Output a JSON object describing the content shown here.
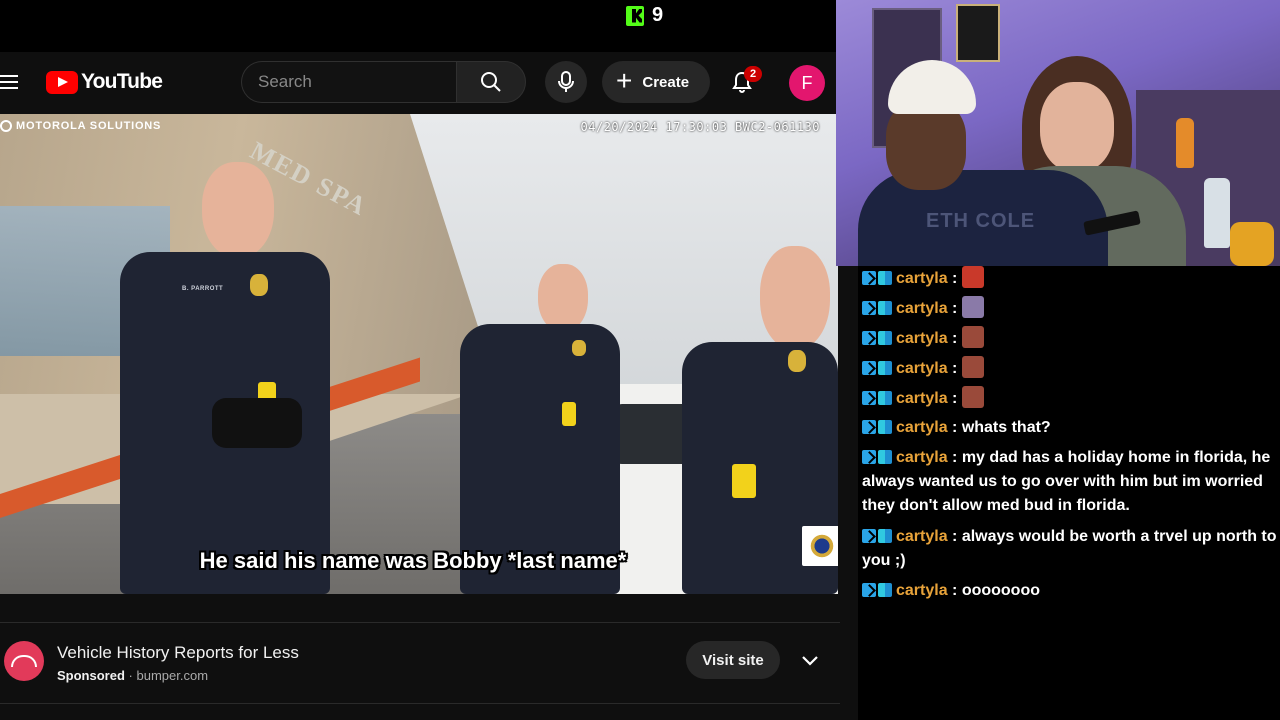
{
  "kick": {
    "viewer_count": "9",
    "logo_icon": "kick-logo-icon"
  },
  "youtube": {
    "logo_text": "YouTube",
    "search": {
      "placeholder": "Search"
    },
    "create_label": "Create",
    "notifications_count": "2",
    "avatar_letter": "F",
    "colors": {
      "brand_red": "#ff0000",
      "avatar_bg": "#e3166e",
      "badge_red": "#cc0000"
    }
  },
  "video": {
    "bwc_brand": "MOTOROLA SOLUTIONS",
    "bwc_stamp": "04/20/2024 17:30:03 BWC2-061130",
    "storefront_sign": "MED SPA",
    "officer_nametag": "B. PARROTT",
    "subtitle": "He said his name was Bobby *last name*"
  },
  "ad": {
    "title": "Vehicle History Reports for Less",
    "sponsored": "Sponsored",
    "separator": "·",
    "domain": "bumper.com",
    "visit_label": "Visit site"
  },
  "webcam": {
    "shirt_text": "ETH COLE"
  },
  "chat": {
    "colors": {
      "username": "#e8a33a",
      "badge": "#2aa5e8"
    },
    "messages": [
      {
        "user": "cartyla",
        "sep": ":",
        "text": "",
        "emote": "red-emote"
      },
      {
        "user": "cartyla",
        "sep": ":",
        "text": "",
        "emote": "face-emote"
      },
      {
        "user": "cartyla",
        "sep": ":",
        "text": "",
        "emote": "brown-emote"
      },
      {
        "user": "cartyla",
        "sep": ":",
        "text": "",
        "emote": "brown-emote"
      },
      {
        "user": "cartyla",
        "sep": ":",
        "text": "",
        "emote": "brown-emote"
      },
      {
        "user": "cartyla",
        "sep": ":",
        "text": "whats that?"
      },
      {
        "user": "cartyla",
        "sep": ":",
        "text": "my dad has a holiday home in florida, he always wanted us to go over with him but im worried they don't allow med bud in florida."
      },
      {
        "user": "cartyla",
        "sep": ":",
        "text": "always would be worth a trvel up north to you ;)"
      },
      {
        "user": "cartyla",
        "sep": ":",
        "text": "oooooooo"
      }
    ]
  }
}
